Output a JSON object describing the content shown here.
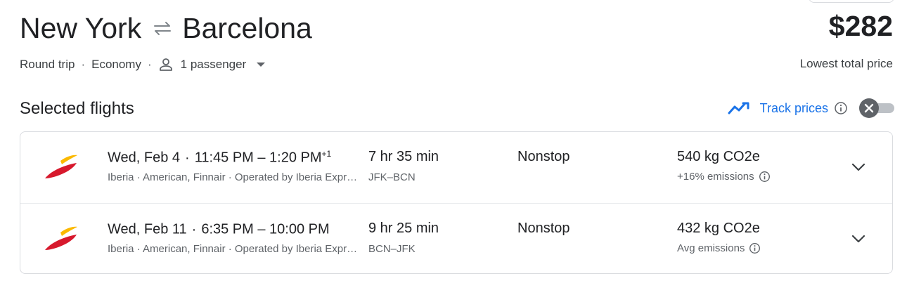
{
  "header": {
    "origin": "New York",
    "destination": "Barcelona",
    "swap_icon": "swap-arrows-icon",
    "price": "$282",
    "price_caption": "Lowest total price"
  },
  "trip_options": {
    "trip_type": "Round trip",
    "separator": "·",
    "cabin": "Economy",
    "passengers": "1 passenger",
    "passenger_icon": "person-icon",
    "dropdown_icon": "caret-down-icon"
  },
  "section": {
    "title": "Selected flights"
  },
  "track_prices": {
    "label": "Track prices",
    "icon": "trending-icon",
    "info_icon": "info-icon",
    "toggle_on": false,
    "accent_color": "#1a73e8"
  },
  "flights": [
    {
      "airline_logo": "iberia-logo",
      "date": "Wed, Feb 4",
      "times": "11:45 PM – 1:20 PM",
      "day_offset": "+1",
      "carriers": "Iberia · American, Finnair · Operated by Iberia Express",
      "duration": "7 hr 35 min",
      "airports": "JFK–BCN",
      "stops": "Nonstop",
      "emissions": "540 kg CO2e",
      "emissions_note": "+16% emissions"
    },
    {
      "airline_logo": "iberia-logo",
      "date": "Wed, Feb 11",
      "times": "6:35 PM – 10:00 PM",
      "day_offset": "",
      "carriers": "Iberia · American, Finnair · Operated by Iberia Express",
      "duration": "9 hr 25 min",
      "airports": "BCN–JFK",
      "stops": "Nonstop",
      "emissions": "432 kg CO2e",
      "emissions_note": "Avg emissions"
    }
  ],
  "colors": {
    "text_primary": "#202124",
    "text_secondary": "#5f6368",
    "iberia_red": "#d7192d",
    "iberia_yellow": "#fbb900"
  }
}
